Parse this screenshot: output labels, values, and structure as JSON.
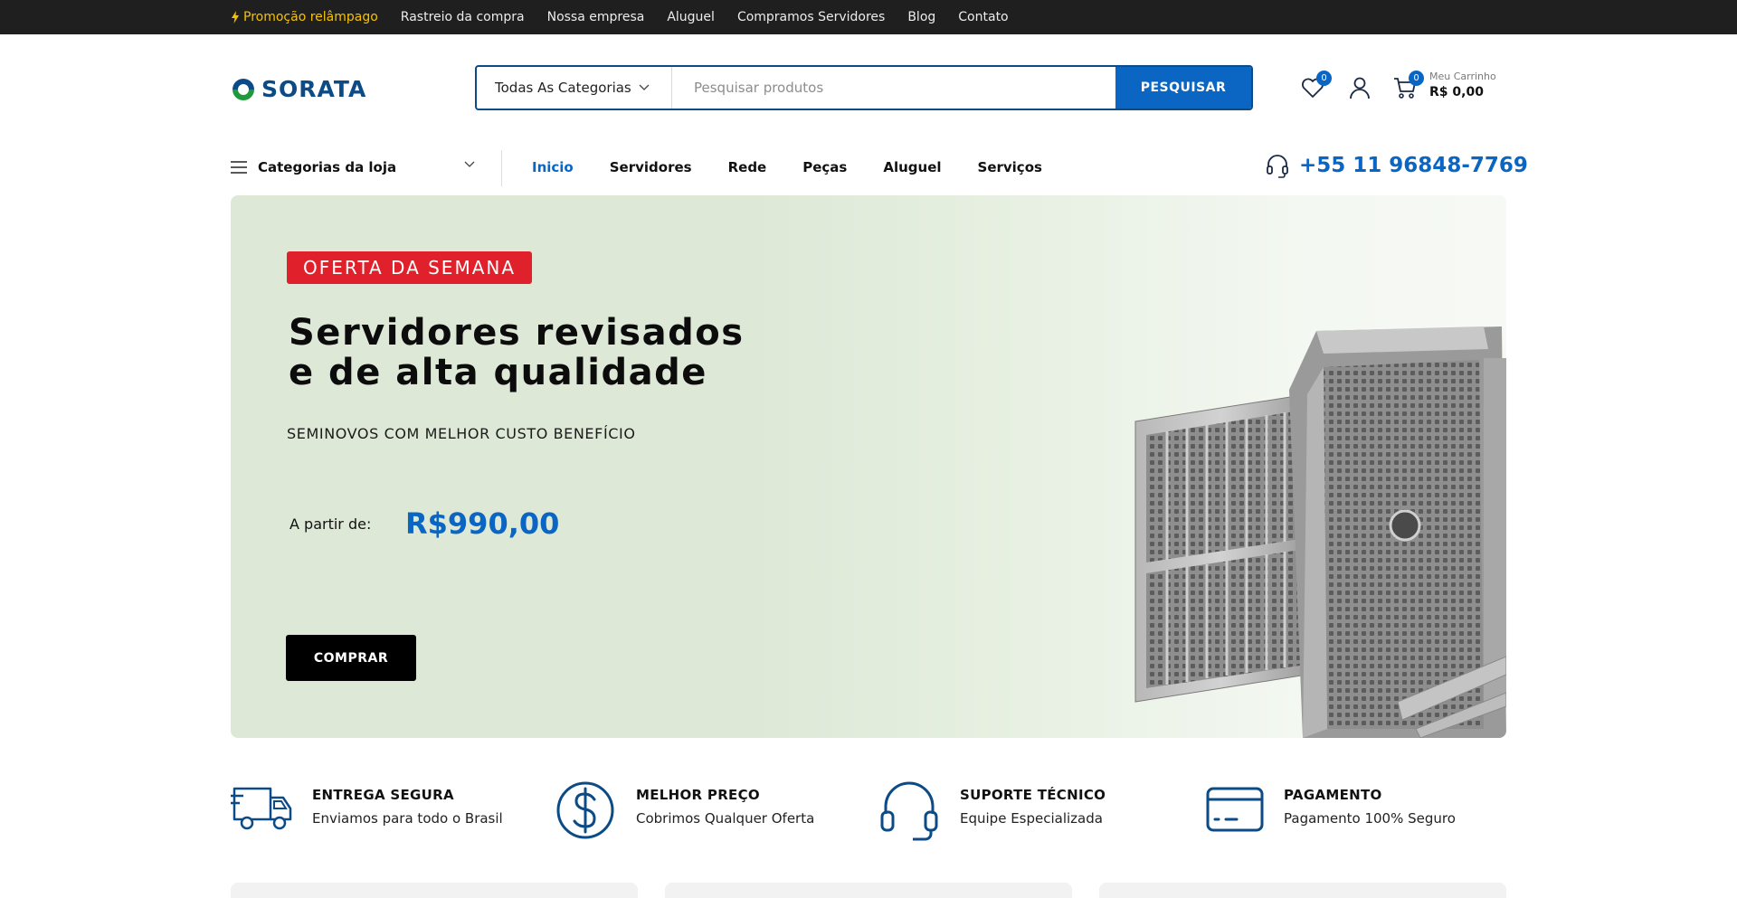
{
  "topbar": {
    "links": [
      {
        "label": "Promoção relâmpago"
      },
      {
        "label": "Rastreio da compra"
      },
      {
        "label": "Nossa empresa"
      },
      {
        "label": "Aluguel"
      },
      {
        "label": "Compramos Servidores"
      },
      {
        "label": "Blog"
      },
      {
        "label": "Contato"
      }
    ]
  },
  "header": {
    "logo_text": "SORATA",
    "search": {
      "category": "Todas As Categorias",
      "placeholder": "Pesquisar produtos",
      "button": "PESQUISAR"
    },
    "wishlist_count": "0",
    "cart_count": "0",
    "cart_label": "Meu Carrinho",
    "cart_total": "R$ 0,00"
  },
  "nav": {
    "categories_label": "Categorias da loja",
    "items": [
      {
        "label": "Inicio"
      },
      {
        "label": "Servidores"
      },
      {
        "label": "Rede"
      },
      {
        "label": "Peças"
      },
      {
        "label": "Aluguel"
      },
      {
        "label": "Serviços"
      }
    ],
    "phone": "+55 11 96848-7769"
  },
  "hero": {
    "badge": "OFERTA DA SEMANA",
    "title_line1": "Servidores revisados",
    "title_line2": "e de alta qualidade",
    "subtitle": "SEMINOVOS COM MELHOR CUSTO BENEFÍCIO",
    "from_label": "A partir de:",
    "price": "R$990,00",
    "button": "COMPRAR"
  },
  "features": [
    {
      "title": "ENTREGA SEGURA",
      "desc": "Enviamos para todo o Brasil",
      "icon": "truck-icon"
    },
    {
      "title": "MELHOR PREÇO",
      "desc": "Cobrimos Qualquer Oferta",
      "icon": "dollar-icon"
    },
    {
      "title": "SUPORTE TÉCNICO",
      "desc": "Equipe Especializada",
      "icon": "headset-icon"
    },
    {
      "title": "PAGAMENTO",
      "desc": "Pagamento 100% Seguro",
      "icon": "credit-card-icon"
    }
  ],
  "colors": {
    "accent": "#0a66c2",
    "brand": "#0c4b86",
    "badge_red": "#e0202b",
    "promo_yellow": "#f6c200",
    "hero_bg": "#dde8d6"
  }
}
